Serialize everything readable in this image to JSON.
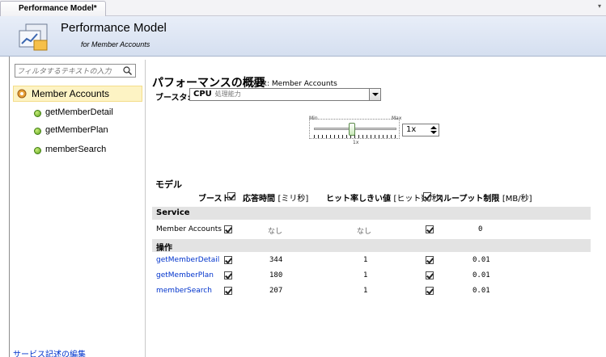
{
  "tab": {
    "title": "Performance Model*",
    "menu_glyph": "▾"
  },
  "banner": {
    "title": "Performance Model",
    "subtitle": "for Member Accounts"
  },
  "sidebar": {
    "filter_placeholder": "フィルタするテキストの入力",
    "root": "Member Accounts",
    "items": [
      {
        "label": "getMemberDetail"
      },
      {
        "label": "getMemberPlan"
      },
      {
        "label": "memberSearch"
      }
    ],
    "edit_link": "サービス記述の編集"
  },
  "overview": {
    "heading": "パフォーマンスの概要",
    "target_label": "対象: Member Accounts",
    "boost_label": "ブースタ:",
    "boost_value": "CPU",
    "boost_value_sub": "処理能力",
    "slider": {
      "min_label": "Min",
      "max_label": "Max",
      "tick_label": "1x",
      "level": 0.5
    },
    "multiplier": "1x"
  },
  "model": {
    "title": "モデル",
    "columns": {
      "boost": "ブースト",
      "response": "応答時間",
      "response_unit": "[ミリ秒]",
      "hitrate": "ヒット率しきい値",
      "hitrate_unit": "[ヒット数/秒]",
      "throughput": "スループット制限",
      "throughput_unit": "[MB/秒]"
    },
    "service_section": "Service",
    "service_row": {
      "name": "Member Accounts",
      "response": "なし",
      "hitrate": "なし",
      "throughput": "0"
    },
    "ops_section": "操作",
    "operations": [
      {
        "name": "getMemberDetail",
        "response": "344",
        "hitrate": "1",
        "throughput": "0.01"
      },
      {
        "name": "getMemberPlan",
        "response": "180",
        "hitrate": "1",
        "throughput": "0.01"
      },
      {
        "name": "memberSearch",
        "response": "207",
        "hitrate": "1",
        "throughput": "0.01"
      }
    ]
  }
}
